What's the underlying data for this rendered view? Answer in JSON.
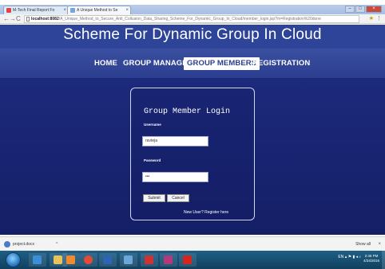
{
  "browser": {
    "tabs": [
      {
        "label": "M-Tech Final Report Fo",
        "active": false
      },
      {
        "label": "A Unique Method to Se",
        "active": true
      }
    ],
    "address": {
      "host": "localhost:8082",
      "path": "/A_Unique_Method_to_Secure_Anti_Collusion_Data_Sharing_Scheme_For_Dynamic_Group_In_Cloud/member_login.jsp?m=Registration%20done"
    }
  },
  "site": {
    "title": "Scheme For Dynamic Group In Cloud",
    "nav": [
      "HOME",
      "GROUP MANAGER",
      "GROUP MEMBERS",
      "REGISTRATION"
    ],
    "active_nav": "GROUP MEMBERS"
  },
  "login": {
    "title": "Group Member Login",
    "username_label": "Username",
    "username_value": "ravteja",
    "password_label": "Password",
    "password_value": "•••",
    "submit_label": "Submit",
    "cancel_label": "Cancel",
    "register_link": "New User? Register here"
  },
  "downloads": {
    "item": "project.docx",
    "show_all": "Show all"
  },
  "taskbar": {
    "clock_time": "2:46 PM",
    "clock_date": "4/24/2016",
    "lang": "EN"
  },
  "colors": {
    "title_band": "#2e4499",
    "content_bg": "#14206a",
    "heading_blue": "#1a3a9c"
  }
}
